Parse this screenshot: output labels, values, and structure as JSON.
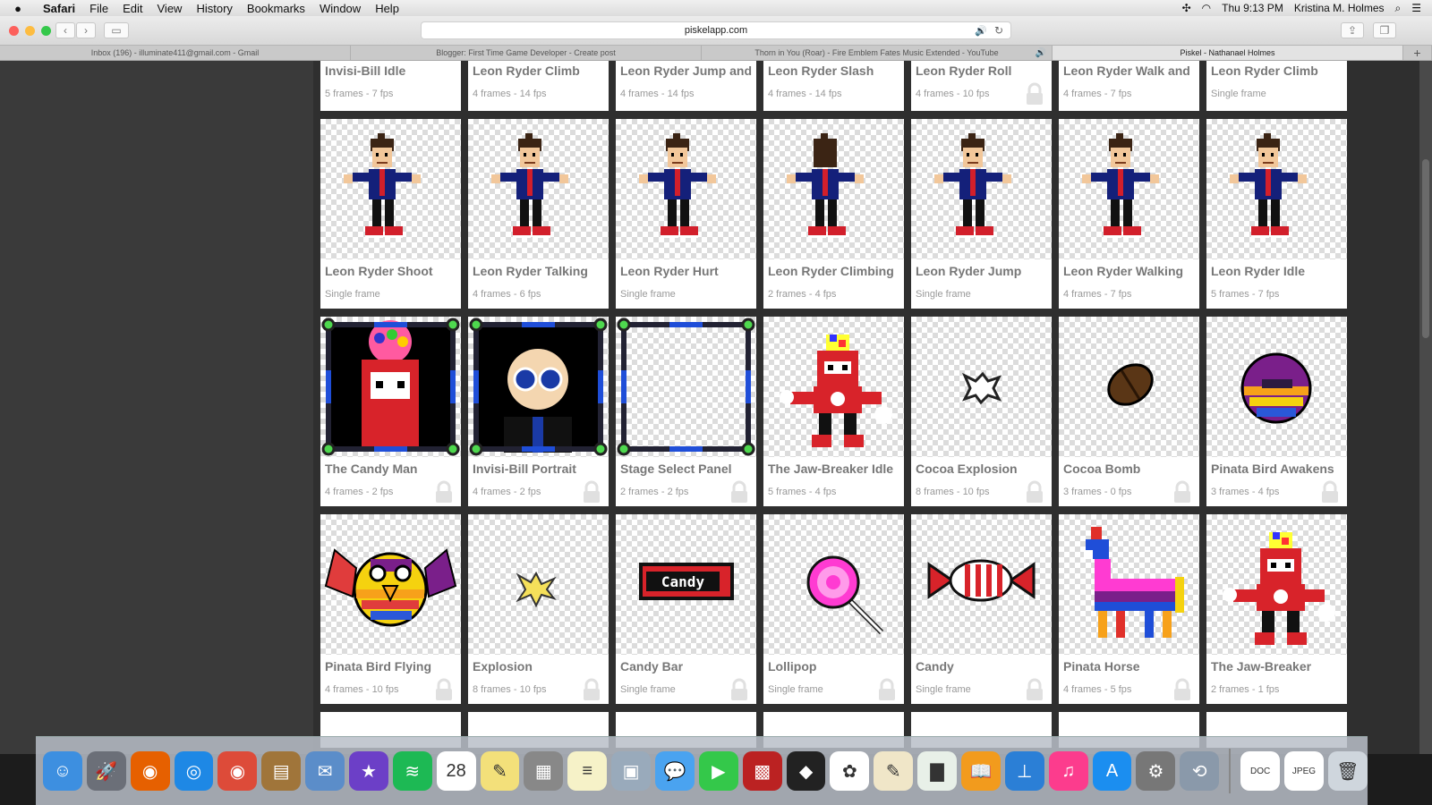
{
  "menubar": {
    "app": "Safari",
    "items": [
      "File",
      "Edit",
      "View",
      "History",
      "Bookmarks",
      "Window",
      "Help"
    ],
    "clock": "Thu 9:13 PM",
    "user": "Kristina M. Holmes"
  },
  "toolbar": {
    "url": "piskelapp.com"
  },
  "tabs": [
    {
      "label": "Inbox (196) - illuminate411@gmail.com - Gmail",
      "active": false
    },
    {
      "label": "Blogger: First Time Game Developer - Create post",
      "active": false
    },
    {
      "label": "Thorn in You (Roar) - Fire Emblem Fates Music Extended - YouTube",
      "active": false,
      "audio": "🔊"
    },
    {
      "label": "Piskel - Nathanael Holmes",
      "active": true
    }
  ],
  "new_tab": "+",
  "gallery": {
    "rows": [
      {
        "cards": [
          {
            "title": "Invisi-Bill Idle",
            "meta": "5 frames - 7 fps",
            "locked": false
          },
          {
            "title": "Leon Ryder Climb",
            "meta": "4 frames - 14 fps",
            "locked": false
          },
          {
            "title": "Leon Ryder Jump and",
            "meta": "4 frames - 14 fps",
            "locked": false
          },
          {
            "title": "Leon Ryder Slash",
            "meta": "4 frames - 14 fps",
            "locked": false
          },
          {
            "title": "Leon Ryder Roll",
            "meta": "4 frames - 10 fps",
            "locked": true
          },
          {
            "title": "Leon Ryder Walk and",
            "meta": "4 frames - 7 fps",
            "locked": false
          },
          {
            "title": "Leon Ryder Climb",
            "meta": "Single frame",
            "locked": false
          }
        ]
      },
      {
        "cards": [
          {
            "title": "Leon Ryder Shoot",
            "meta": "Single frame",
            "locked": false,
            "sprite": "leon"
          },
          {
            "title": "Leon Ryder Talking",
            "meta": "4 frames - 6 fps",
            "locked": false,
            "sprite": "leon"
          },
          {
            "title": "Leon Ryder Hurt",
            "meta": "Single frame",
            "locked": false,
            "sprite": "leon"
          },
          {
            "title": "Leon Ryder Climbing",
            "meta": "2 frames - 4 fps",
            "locked": false,
            "sprite": "leon-back"
          },
          {
            "title": "Leon Ryder Jump",
            "meta": "Single frame",
            "locked": false,
            "sprite": "leon"
          },
          {
            "title": "Leon Ryder Walking",
            "meta": "4 frames - 7 fps",
            "locked": false,
            "sprite": "leon"
          },
          {
            "title": "Leon Ryder Idle",
            "meta": "5 frames - 7 fps",
            "locked": false,
            "sprite": "leon"
          }
        ]
      },
      {
        "cards": [
          {
            "title": "The Candy Man",
            "meta": "4 frames - 2 fps",
            "locked": true,
            "sprite": "candyman"
          },
          {
            "title": "Invisi-Bill Portrait",
            "meta": "4 frames - 2 fps",
            "locked": true,
            "sprite": "bill"
          },
          {
            "title": "Stage Select Panel",
            "meta": "2 frames - 2 fps",
            "locked": true,
            "sprite": "panel"
          },
          {
            "title": "The Jaw-Breaker Idle",
            "meta": "5 frames - 4 fps",
            "locked": false,
            "sprite": "jawbreaker"
          },
          {
            "title": "Cocoa Explosion",
            "meta": "8 frames - 10 fps",
            "locked": true,
            "sprite": "cocoa-explosion"
          },
          {
            "title": "Cocoa Bomb",
            "meta": "3 frames - 0 fps",
            "locked": true,
            "sprite": "cocoa-bomb"
          },
          {
            "title": "Pinata Bird Awakens",
            "meta": "3 frames - 4 fps",
            "locked": true,
            "sprite": "bird-ball"
          }
        ]
      },
      {
        "cards": [
          {
            "title": "Pinata Bird Flying",
            "meta": "4 frames - 10 fps",
            "locked": true,
            "sprite": "bird"
          },
          {
            "title": "Explosion",
            "meta": "8 frames - 10 fps",
            "locked": true,
            "sprite": "explosion"
          },
          {
            "title": "Candy Bar",
            "meta": "Single frame",
            "locked": true,
            "sprite": "candybar",
            "sprite_text": "Candy"
          },
          {
            "title": "Lollipop",
            "meta": "Single frame",
            "locked": true,
            "sprite": "lollipop"
          },
          {
            "title": "Candy",
            "meta": "Single frame",
            "locked": true,
            "sprite": "candy"
          },
          {
            "title": "Pinata Horse",
            "meta": "4 frames - 5 fps",
            "locked": true,
            "sprite": "horse"
          },
          {
            "title": "The Jaw-Breaker",
            "meta": "2 frames - 1 fps",
            "locked": false,
            "sprite": "jawbreaker"
          }
        ]
      }
    ]
  },
  "dock": {
    "apps": [
      {
        "name": "finder-icon",
        "color": "#3d8fe0",
        "glyph": "☺"
      },
      {
        "name": "launchpad-icon",
        "color": "#6b6f78",
        "glyph": "🚀"
      },
      {
        "name": "firefox-icon",
        "color": "#e66000",
        "glyph": "◉"
      },
      {
        "name": "safari-icon",
        "color": "#1e88e5",
        "glyph": "◎"
      },
      {
        "name": "chrome-icon",
        "color": "#dd4b39",
        "glyph": "◉"
      },
      {
        "name": "contacts-icon",
        "color": "#a0753a",
        "glyph": "▤"
      },
      {
        "name": "preview-icon",
        "color": "#5b8dc9",
        "glyph": "✉"
      },
      {
        "name": "imovie-icon",
        "color": "#6c3fc7",
        "glyph": "★"
      },
      {
        "name": "spotify-icon",
        "color": "#1db954",
        "glyph": "≋"
      },
      {
        "name": "calendar-icon",
        "color": "#ffffff",
        "glyph": "28"
      },
      {
        "name": "stickies-icon",
        "color": "#f3e07a",
        "glyph": "✎"
      },
      {
        "name": "calculator-icon",
        "color": "#888888",
        "glyph": "▦"
      },
      {
        "name": "notes-icon",
        "color": "#f6f2c8",
        "glyph": "≡"
      },
      {
        "name": "photo-booth-icon",
        "color": "#9ab",
        "glyph": "▣"
      },
      {
        "name": "messages-icon",
        "color": "#4aa3f0",
        "glyph": "💬"
      },
      {
        "name": "facetime-icon",
        "color": "#34c84a",
        "glyph": "▶"
      },
      {
        "name": "photo-booth-2-icon",
        "color": "#b22",
        "glyph": "▩"
      },
      {
        "name": "unity-icon",
        "color": "#222222",
        "glyph": "◆"
      },
      {
        "name": "photos-icon",
        "color": "#ffffff",
        "glyph": "✿"
      },
      {
        "name": "textedit-icon",
        "color": "#f0e6c8",
        "glyph": "✎"
      },
      {
        "name": "numbers-icon",
        "color": "#e8f0e8",
        "glyph": "▇"
      },
      {
        "name": "ibooks-icon",
        "color": "#f29b1d",
        "glyph": "📖"
      },
      {
        "name": "keynote-icon",
        "color": "#2b7fd6",
        "glyph": "⊥"
      },
      {
        "name": "itunes-icon",
        "color": "#fc3c8d",
        "glyph": "♫"
      },
      {
        "name": "app-store-icon",
        "color": "#1b8ef0",
        "glyph": "A"
      },
      {
        "name": "system-preferences-icon",
        "color": "#777777",
        "glyph": "⚙"
      },
      {
        "name": "cleaner-icon",
        "color": "#8a99aa",
        "glyph": "⟲"
      },
      {
        "name": "separator",
        "color": "",
        "glyph": ""
      },
      {
        "name": "document-icon",
        "color": "#ffffff",
        "glyph": "DOC"
      },
      {
        "name": "jpeg-icon",
        "color": "#ffffff",
        "glyph": "JPEG"
      },
      {
        "name": "trash-icon",
        "color": "#cfd6dd",
        "glyph": "🗑"
      }
    ]
  }
}
